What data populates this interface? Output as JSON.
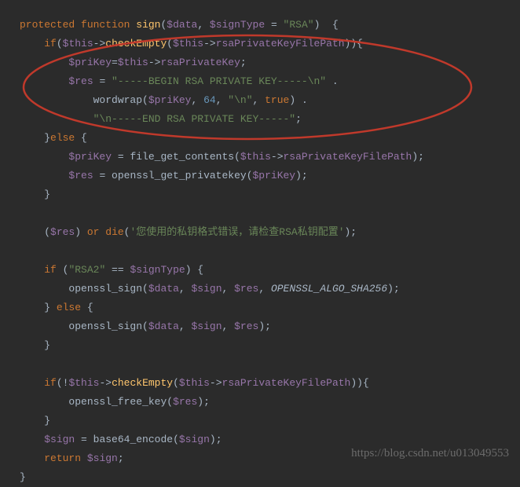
{
  "code": {
    "l1_kw1": "protected",
    "l1_kw2": "function",
    "l1_fn": "sign",
    "l1_p1": "$data",
    "l1_p2": "$signType",
    "l1_str": "\"RSA\"",
    "l2_kw": "if",
    "l2_this": "$this",
    "l2_call": "checkEmpty",
    "l2_this2": "$this",
    "l2_prop": "rsaPrivateKeyFilePath",
    "l3_v": "$priKey",
    "l3_this": "$this",
    "l3_prop": "rsaPrivateKey",
    "l4_v": "$res",
    "l4_str": "\"-----BEGIN RSA PRIVATE KEY-----\\n\"",
    "l5_call": "wordwrap",
    "l5_v": "$priKey",
    "l5_n": "64",
    "l5_str": "\"\\n\"",
    "l5_kw": "true",
    "l6_str": "\"\\n-----END RSA PRIVATE KEY-----\"",
    "l7_kw": "else",
    "l8_v": "$priKey",
    "l8_call": "file_get_contents",
    "l8_this": "$this",
    "l8_prop": "rsaPrivateKeyFilePath",
    "l9_v": "$res",
    "l9_call": "openssl_get_privatekey",
    "l9_arg": "$priKey",
    "l11_v": "$res",
    "l11_kw1": "or",
    "l11_kw2": "die",
    "l11_str": "'您使用的私钥格式错误，请检查RSA私钥配置'",
    "l13_kw": "if",
    "l13_str": "\"RSA2\"",
    "l13_v": "$signType",
    "l14_call": "openssl_sign",
    "l14_a1": "$data",
    "l14_a2": "$sign",
    "l14_a3": "$res",
    "l14_a4": "OPENSSL_ALGO_SHA256",
    "l15_kw": "else",
    "l16_call": "openssl_sign",
    "l16_a1": "$data",
    "l16_a2": "$sign",
    "l16_a3": "$res",
    "l18_kw": "if",
    "l18_this": "$this",
    "l18_call": "checkEmpty",
    "l18_this2": "$this",
    "l18_prop": "rsaPrivateKeyFilePath",
    "l19_call": "openssl_free_key",
    "l19_arg": "$res",
    "l21_v": "$sign",
    "l21_call": "base64_encode",
    "l21_arg": "$sign",
    "l22_kw": "return",
    "l22_v": "$sign"
  },
  "watermark": "https://blog.csdn.net/u013049553"
}
